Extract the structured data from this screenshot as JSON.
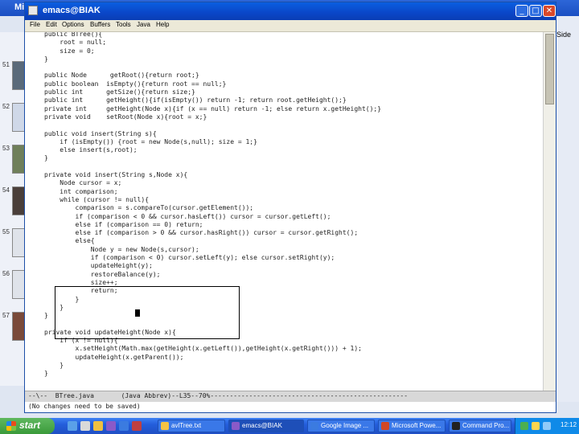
{
  "background_app": {
    "title": "Mic",
    "side_label": "Side",
    "slides": [
      {
        "number": "51"
      },
      {
        "number": "52"
      },
      {
        "number": "53"
      },
      {
        "number": "54"
      },
      {
        "number": "55"
      },
      {
        "number": "56"
      },
      {
        "number": "57"
      }
    ]
  },
  "window": {
    "title": "emacs@BIAK",
    "minimize_label": "_",
    "maximize_label": "□",
    "close_label": "✕"
  },
  "menu": [
    "File",
    "Edit",
    "Options",
    "Buffers",
    "Tools",
    "Java",
    "Help"
  ],
  "code": [
    "public BTree(){",
    "    root = null;",
    "    size = 0;",
    "}",
    "",
    "public Node      getRoot(){return root;}",
    "public boolean  isEmpty(){return root == null;}",
    "public int      getSize(){return size;}",
    "public int      getHeight(){if(isEmpty()) return -1; return root.getHeight();}",
    "private int     getHeight(Node x){if (x == null) return -1; else return x.getHeight();}",
    "private void    setRoot(Node x){root = x;}",
    "",
    "public void insert(String s){",
    "    if (isEmpty()) {root = new Node(s,null); size = 1;}",
    "    else insert(s,root);",
    "}",
    "",
    "private void insert(String s,Node x){",
    "    Node cursor = x;",
    "    int comparison;",
    "    while (cursor != null){",
    "        comparison = s.compareTo(cursor.getElement());",
    "        if (comparison < 0 && cursor.hasLeft()) cursor = cursor.getLeft();",
    "        else if (comparison == 0) return;",
    "        else if (comparison > 0 && cursor.hasRight()) cursor = cursor.getRight();",
    "        else{",
    "            Node y = new Node(s,cursor);",
    "            if (comparison < 0) cursor.setLeft(y); else cursor.setRight(y);",
    "            updateHeight(y);",
    "            restoreBalance(y);",
    "            size++;",
    "            return;",
    "        }",
    "    }",
    "}",
    "",
    "private void updateHeight(Node x){",
    "    if (x != null){",
    "        x.setHeight(Math.max(getHeight(x.getLeft()),getHeight(x.getRight())) + 1);",
    "        updateHeight(x.getParent());",
    "    }",
    "}"
  ],
  "modeline": "--\\--  BTree.java       (Java Abbrev)--L35--70%---------------------------------------------------",
  "minibuffer": "(No changes need to be saved)",
  "taskbar": {
    "start_label": "start",
    "tasks": [
      {
        "label": "avlTree.txt",
        "color": "#f6c343",
        "active": false
      },
      {
        "label": "emacs@BIAK",
        "color": "#8a5ac8",
        "active": true
      },
      {
        "label": "Google Image ...",
        "color": "#3b7be0",
        "active": false
      },
      {
        "label": "Microsoft Powe...",
        "color": "#d24726",
        "active": false
      },
      {
        "label": "Command Pro...",
        "color": "#222222",
        "active": false
      }
    ],
    "clock": "12:12"
  }
}
